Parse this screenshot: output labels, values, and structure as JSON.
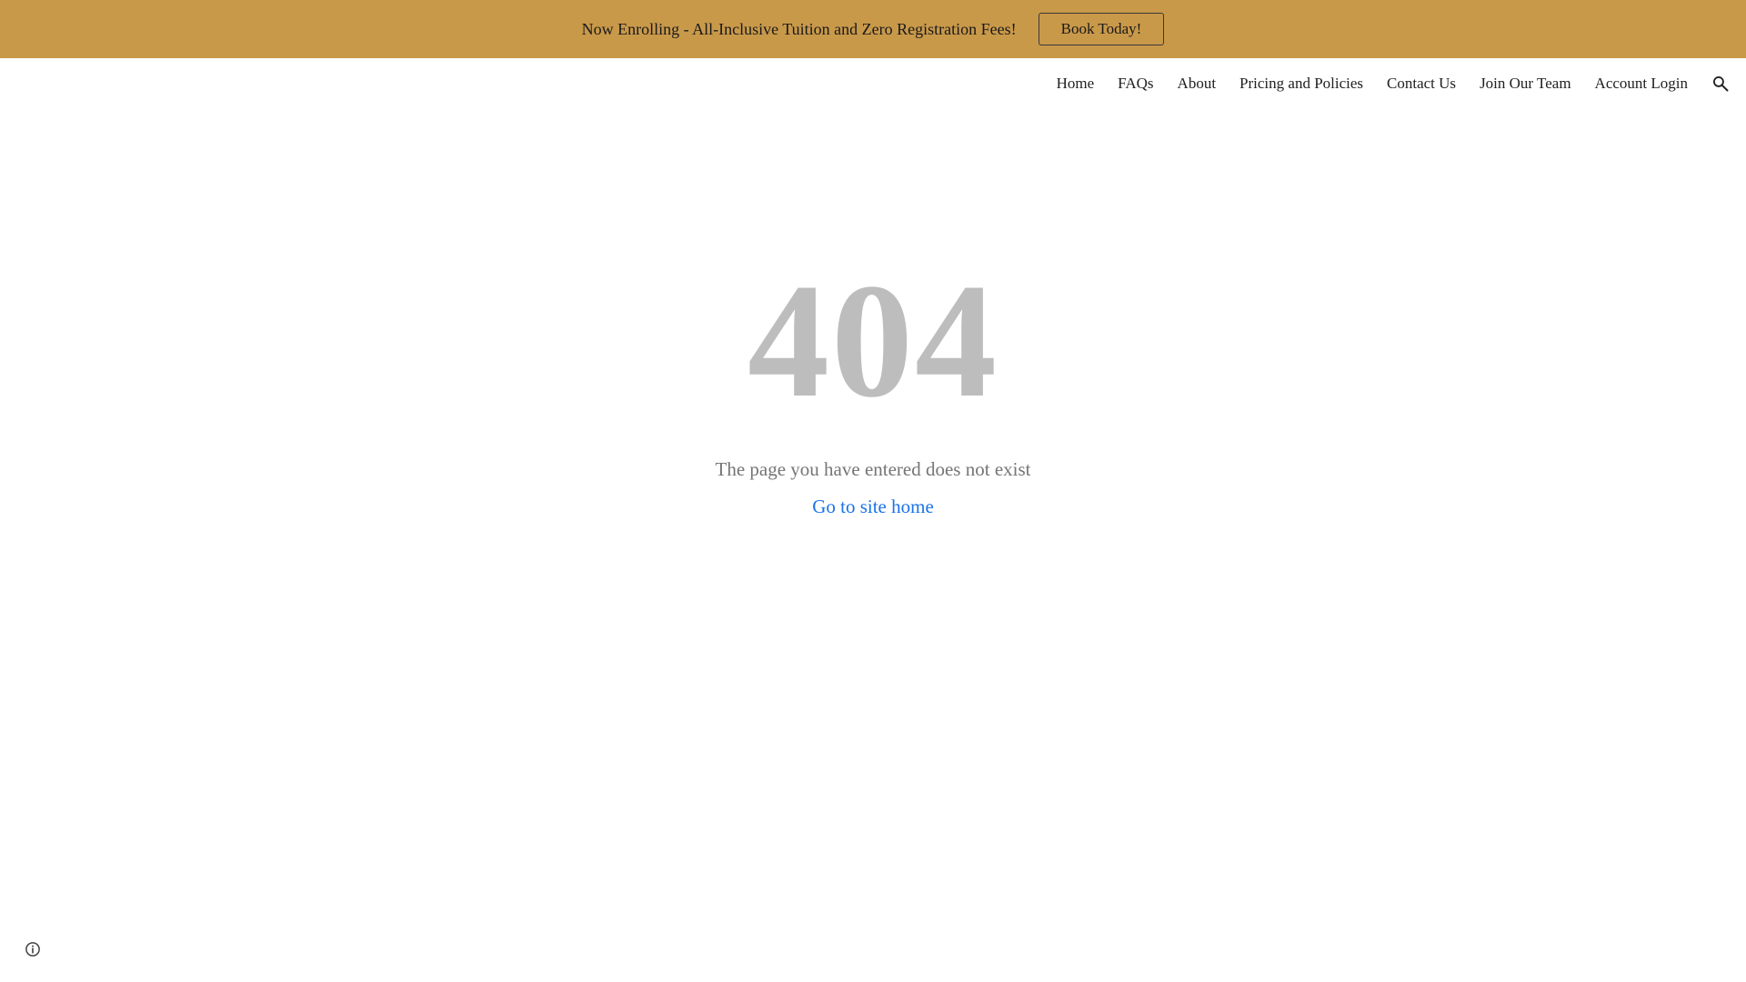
{
  "banner": {
    "text": "Now Enrolling - All-Inclusive Tuition and Zero Registration Fees!",
    "button_label": "Book Today!",
    "background": "#c9994a"
  },
  "nav": {
    "items": [
      {
        "label": "Home"
      },
      {
        "label": "FAQs"
      },
      {
        "label": "About"
      },
      {
        "label": "Pricing and Policies"
      },
      {
        "label": "Contact Us"
      },
      {
        "label": "Join Our Team"
      },
      {
        "label": "Account Login"
      }
    ],
    "search_icon": "search-icon"
  },
  "error": {
    "code": "404",
    "message": "The page you have entered does not exist",
    "home_link": "Go to site home"
  },
  "footer": {
    "info_icon": "info-icon"
  },
  "colors": {
    "code": "#bdbdbd",
    "message": "#757575",
    "link": "#1a73e8"
  }
}
